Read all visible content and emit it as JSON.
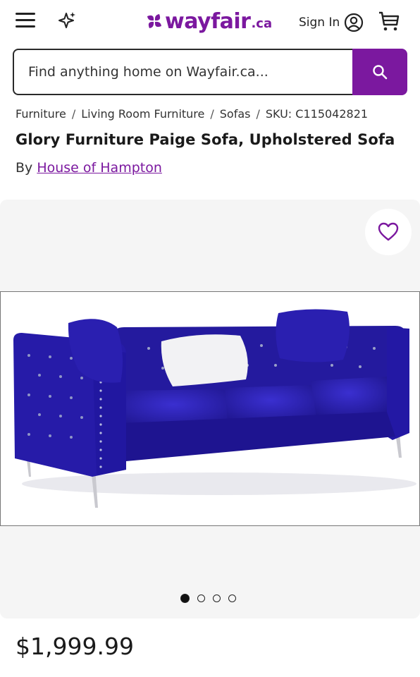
{
  "header": {
    "logo_word": "wayfair",
    "logo_tld": ".ca",
    "sign_in_label": "Sign In",
    "brand_color": "#7b189f",
    "icons": [
      "hamburger-menu-icon",
      "sparkle-icon",
      "account-icon",
      "cart-icon"
    ]
  },
  "search": {
    "placeholder": "Find anything home on Wayfair.ca...",
    "value": "",
    "button_icon": "search-icon"
  },
  "breadcrumb": {
    "items": [
      "Furniture",
      "Living Room Furniture",
      "Sofas"
    ],
    "separator": "/",
    "sku": "SKU: C115042821"
  },
  "product": {
    "title": "Glory Furniture Paige Sofa, Upholstered Sofa",
    "by_label": "By",
    "brand": "House of Hampton",
    "price": "$1,999.99",
    "image_subject": "blue tufted velvet three-seat sofa with pillows",
    "sofa_color": "#2a1fb0",
    "gallery": {
      "image_count": 4,
      "active_index": 0
    },
    "favorite_icon": "heart-outline-icon"
  }
}
